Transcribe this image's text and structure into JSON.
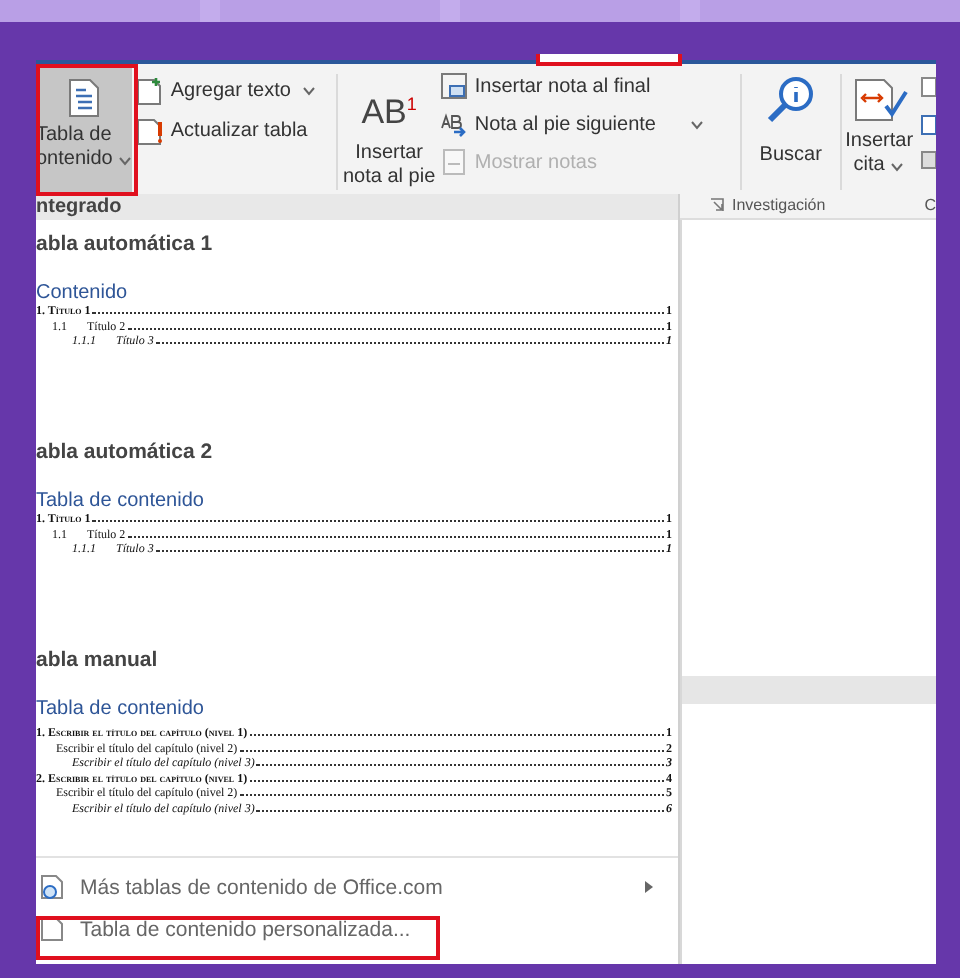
{
  "ribbon": {
    "toc_button": {
      "label_lines": [
        "Tabla de",
        "ontenido"
      ],
      "selected": true
    },
    "table_commands": [
      {
        "kind": "add-text",
        "label": "Agregar texto",
        "dropdown": true
      },
      {
        "kind": "update",
        "label": "Actualizar tabla",
        "dropdown": false
      }
    ],
    "footnote_button": {
      "icon_text": "AB$^{1}$",
      "label_lines": [
        "Insertar",
        "nota al pie"
      ]
    },
    "footnote_commands": [
      {
        "kind": "endnote",
        "label": "Insertar nota al final",
        "disabled": false,
        "dropdown": false
      },
      {
        "kind": "next-note",
        "label": "Nota al pie siguiente",
        "disabled": false,
        "dropdown": true
      },
      {
        "kind": "show-notes",
        "label": "Mostrar notas",
        "disabled": true,
        "dropdown": false
      }
    ],
    "search_button": {
      "label": "Buscar"
    },
    "cite_button": {
      "label_lines": [
        "Insertar",
        "cita"
      ],
      "dropdown": true
    },
    "group_labels": [
      {
        "label": "Investigación",
        "launcher": true
      },
      {
        "label": "C",
        "launcher": false
      }
    ]
  },
  "dropdown": {
    "header": "ntegrado",
    "sections": [
      {
        "title": "abla automática 1",
        "preview_heading": "Contenido",
        "entries": [
          {
            "kind": "level1",
            "text": "1. Título 1",
            "page": "1"
          },
          {
            "kind": "level2",
            "number": "1.1",
            "text": "Título 2",
            "page": "1"
          },
          {
            "kind": "level3",
            "number": "1.1.1",
            "text": "Título 3",
            "page": "1"
          }
        ]
      },
      {
        "title": "abla automática 2",
        "preview_heading": "Tabla de contenido",
        "entries": [
          {
            "kind": "level1",
            "text": "1. Título 1",
            "page": "1"
          },
          {
            "kind": "level2",
            "number": "1.1",
            "text": "Título 2",
            "page": "1"
          },
          {
            "kind": "level3",
            "number": "1.1.1",
            "text": "Título 3",
            "page": "1"
          }
        ]
      },
      {
        "title": "abla manual",
        "preview_heading": "Tabla de contenido",
        "entries": [
          {
            "kind": "level1",
            "text": "1. Escribir el título del capítulo (nivel 1)",
            "page": "1"
          },
          {
            "kind": "level2",
            "text": "Escribir el título del capítulo (nivel 2)",
            "page": "2"
          },
          {
            "kind": "level3",
            "text": "Escribir el título del capítulo (nivel 3)",
            "page": "3"
          },
          {
            "kind": "level1",
            "text": "2. Escribir el título del capítulo (nivel 1)",
            "page": "4"
          },
          {
            "kind": "level2",
            "text": "Escribir el título del capítulo (nivel 2)",
            "page": "5"
          },
          {
            "kind": "level3",
            "text": "Escribir el título del capítulo (nivel 3)",
            "page": "6"
          }
        ]
      }
    ],
    "menu_items": [
      {
        "kind": "more",
        "label": "Más tablas de contenido de Office.com",
        "submenu": true
      },
      {
        "kind": "custom",
        "label": "Tabla de contenido personalizada...",
        "submenu": false
      }
    ]
  },
  "highlights": [
    {
      "kind": "toc-button"
    },
    {
      "kind": "top-tab"
    },
    {
      "kind": "custom-item"
    }
  ]
}
